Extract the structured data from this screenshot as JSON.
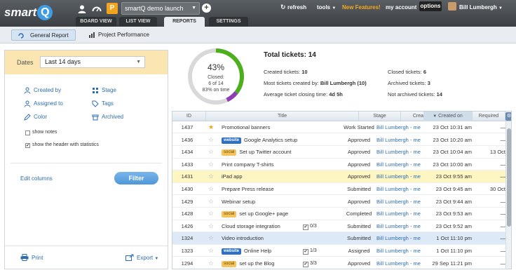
{
  "app": {
    "logo_text": "smart",
    "logo_q": "Q"
  },
  "topbar": {
    "project_icon_letter": "P",
    "project": "smartQ demo launch",
    "refresh": "refresh",
    "tools": "tools",
    "new_features": "New Features!",
    "my_account": "my account",
    "options": "options",
    "user": "Bill Lumbergh"
  },
  "tabs": [
    {
      "label": "BOARD VIEW",
      "active": false
    },
    {
      "label": "LIST VIEW",
      "active": false
    },
    {
      "label": "REPORTS",
      "active": true
    },
    {
      "label": "SETTINGS",
      "active": false
    }
  ],
  "subnav": {
    "general_report": "General Report",
    "project_performance": "Project Performance"
  },
  "left": {
    "dates_label": "Dates",
    "dates_value": "Last 14 days",
    "filters": {
      "created_by": "Created by",
      "assigned_to": "Assigned to",
      "color": "Color",
      "stage": "Stage",
      "tags": "Tags",
      "archived": "Archived"
    },
    "show_notes": "show notes",
    "show_header": "show the header with statistics",
    "show_notes_checked": false,
    "show_header_checked": true,
    "edit_columns": "Edit columns",
    "filter_button": "Filter",
    "print": "Print",
    "export": "Export"
  },
  "stats": {
    "percent_label": "43%",
    "percent": 0.43,
    "closed_label": "Closed:",
    "closed_of": "6 of 14",
    "on_time": "83% on time",
    "total_title": "Total tickets: 14",
    "created_label": "Created tickets:",
    "created_value": "10",
    "most_label": "Most tickets created by:",
    "most_value": "Bill Lumbergh (10)",
    "avg_label": "Average ticket closing time:",
    "avg_value": "4d 5h",
    "closed_tickets_label": "Closed tickets:",
    "closed_tickets_value": "6",
    "archived_label": "Archived tickets:",
    "archived_value": "3",
    "not_archived_label": "Not archived tickets:",
    "not_archived_value": "14",
    "colors": {
      "progress": "#4caf1c",
      "overdue": "#8e3fb5",
      "track": "#d9d9d9"
    }
  },
  "table": {
    "headers": {
      "id": "ID",
      "title": "Title",
      "stage": "Stage",
      "created_by": "Created by",
      "created_on": "Created on",
      "required": "Required"
    },
    "rows": [
      {
        "id": "1437",
        "starred": true,
        "tag": "",
        "title": "Promotional banners",
        "check": "",
        "stage": "Work Started",
        "by": "Bill Lumbergh - me",
        "date": "23 Oct 10:31 am",
        "req": "—",
        "hl": ""
      },
      {
        "id": "1436",
        "starred": false,
        "tag": "website",
        "title": "Google Analytics setup",
        "check": "",
        "stage": "Approved",
        "by": "Bill Lumbergh - me",
        "date": "23 Oct 10:20 am",
        "req": "—",
        "hl": ""
      },
      {
        "id": "1434",
        "starred": false,
        "tag": "social",
        "title": "Set up Twitter account",
        "check": "",
        "stage": "Approved",
        "by": "Bill Lumbergh - me",
        "date": "23 Oct 10:04 am",
        "req": "13 Oct",
        "hl": ""
      },
      {
        "id": "1433",
        "starred": false,
        "tag": "",
        "title": "Print company T-shirts",
        "check": "",
        "stage": "Approved",
        "by": "Bill Lumbergh - me",
        "date": "23 Oct 10:00 am",
        "req": "—",
        "hl": ""
      },
      {
        "id": "1431",
        "starred": false,
        "tag": "",
        "title": "iPad app",
        "check": "",
        "stage": "Approved",
        "by": "Bill Lumbergh - me",
        "date": "23 Oct 9:55 am",
        "req": "—",
        "hl": "yellow"
      },
      {
        "id": "1430",
        "starred": false,
        "tag": "",
        "title": "Prepare Press release",
        "check": "",
        "stage": "Submitted",
        "by": "Bill Lumbergh - me",
        "date": "23 Oct 9:45 am",
        "req": "30 Oct",
        "hl": ""
      },
      {
        "id": "1429",
        "starred": false,
        "tag": "",
        "title": "Webinar setup",
        "check": "",
        "stage": "Approved",
        "by": "Bill Lumbergh - me",
        "date": "23 Oct 9:44 am",
        "req": "—",
        "hl": ""
      },
      {
        "id": "1428",
        "starred": false,
        "tag": "social",
        "title": "set up Google+ page",
        "check": "",
        "stage": "Completed",
        "by": "Bill Lumbergh - me",
        "date": "23 Oct 9:53 am",
        "req": "—",
        "hl": ""
      },
      {
        "id": "1426",
        "starred": false,
        "tag": "",
        "title": "Cloud storage integration",
        "check": "0/3",
        "stage": "Submitted",
        "by": "Bill Lumbergh - me",
        "date": "23 Oct 9:52 am",
        "req": "—",
        "hl": ""
      },
      {
        "id": "1324",
        "starred": false,
        "tag": "",
        "title": "Video introduction",
        "check": "",
        "stage": "Submitted",
        "by": "Bill Lumbergh - me",
        "date": "1 Oct 11:10 pm",
        "req": "—",
        "hl": "blue"
      },
      {
        "id": "1323",
        "starred": false,
        "tag": "website",
        "title": "Online Help",
        "check": "1/3",
        "stage": "Assigned",
        "by": "Bill Lumbergh - me",
        "date": "1 Oct 11:10 pm",
        "req": "—",
        "hl": ""
      },
      {
        "id": "1294",
        "starred": false,
        "tag": "social",
        "title": "set up the Blog",
        "check": "3/3",
        "stage": "Approved",
        "by": "Bill Lumbergh - me",
        "date": "29 Sep 11:21 pm",
        "req": "—",
        "hl": ""
      }
    ]
  }
}
